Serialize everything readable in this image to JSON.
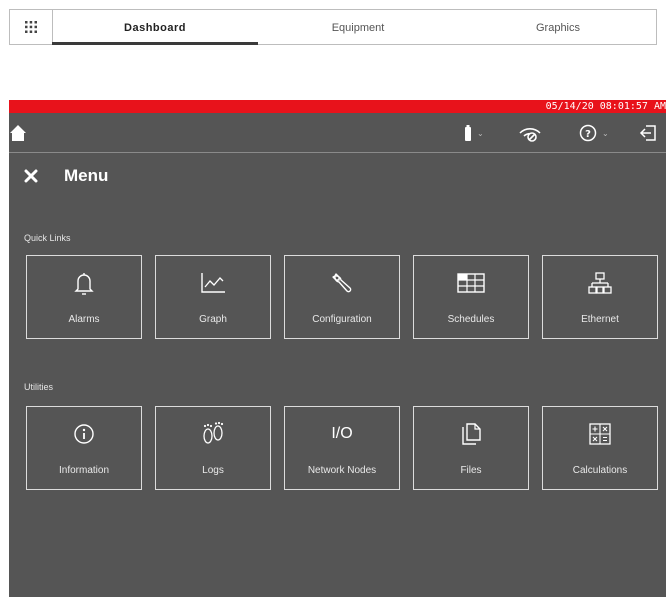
{
  "tabs": [
    {
      "label": "Dashboard",
      "active": true
    },
    {
      "label": "Equipment",
      "active": false
    },
    {
      "label": "Graphics",
      "active": false
    }
  ],
  "status": {
    "datetime": "05/14/20 08:01:57 AM",
    "icons": [
      "home-icon",
      "battery-icon",
      "wireless-off-icon",
      "help-icon",
      "logout-icon"
    ]
  },
  "menu": {
    "title": "Menu",
    "quick_links": {
      "label": "Quick Links",
      "items": [
        {
          "label": "Alarms",
          "icon": "bell-icon"
        },
        {
          "label": "Graph",
          "icon": "graph-icon"
        },
        {
          "label": "Configuration",
          "icon": "wrench-icon"
        },
        {
          "label": "Schedules",
          "icon": "schedule-grid-icon"
        },
        {
          "label": "Ethernet",
          "icon": "network-icon"
        }
      ]
    },
    "utilities": {
      "label": "Utilities",
      "items": [
        {
          "label": "Information",
          "icon": "info-icon"
        },
        {
          "label": "Logs",
          "icon": "footprints-icon"
        },
        {
          "label": "Network Nodes",
          "icon": "io-icon",
          "icon_text": "I/O"
        },
        {
          "label": "Files",
          "icon": "files-icon"
        },
        {
          "label": "Calculations",
          "icon": "calculator-icon"
        }
      ]
    }
  },
  "colors": {
    "accent_red": "#e8121b",
    "screen_bg": "#555555"
  }
}
